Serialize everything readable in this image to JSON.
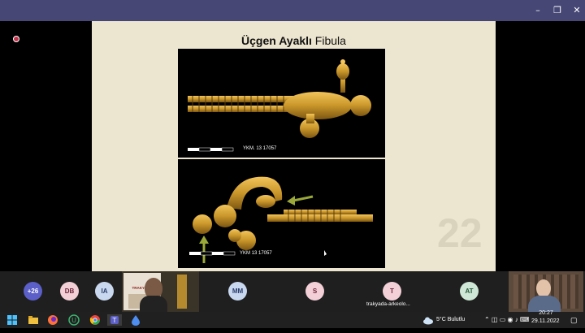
{
  "window": {
    "controls": {
      "minimize": "–",
      "maximize": "❐",
      "close": "✕"
    }
  },
  "slide": {
    "title_bold": "Üçgen Ayaklı",
    "title_rest": " Fibula",
    "catalog_top": "YKM. 13 17057",
    "catalog_bottom": "YKM 13 17057",
    "page_number": "22"
  },
  "participants": {
    "overflow": "+26",
    "tiles": [
      {
        "initials": "DB",
        "bg": "#f3d0d8",
        "fg": "#6b2336"
      },
      {
        "initials": "IA",
        "bg": "#c9d8ef",
        "fg": "#2a3d6b"
      },
      {
        "initials": "MM",
        "bg": "#c9d8ef",
        "fg": "#2a3d6b"
      },
      {
        "initials": "S",
        "bg": "#f3d0d8",
        "fg": "#6b2336"
      },
      {
        "initials": "T",
        "bg": "#f3d0d8",
        "fg": "#6b2336"
      },
      {
        "initials": "AT",
        "bg": "#cfe7d6",
        "fg": "#23573a"
      }
    ],
    "t_label": "trakyada-arkeolo...",
    "thumb_poster_text": "TRAKYA TA"
  },
  "taskbar": {
    "weather": "5°C  Bulutlu",
    "time": "20:27",
    "date": "29.11.2022"
  },
  "colors": {
    "titlebar": "#464775",
    "slide_bg": "#ece5cf",
    "gold": "#c9962a",
    "arrow": "#9aa83a"
  }
}
